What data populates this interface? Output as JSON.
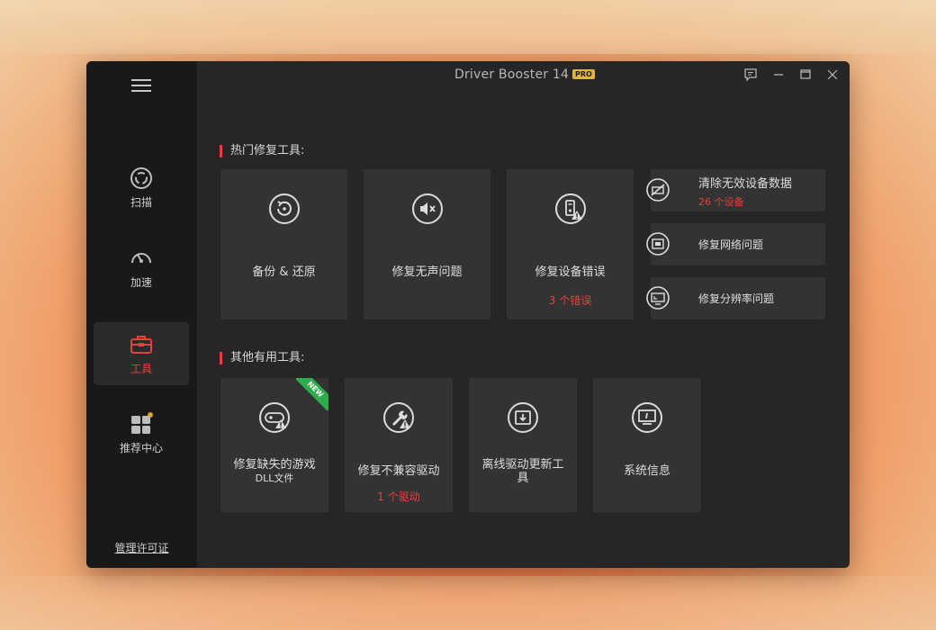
{
  "app": {
    "title": "Driver Booster 14",
    "badge": "PRO"
  },
  "sidebar": {
    "items": [
      {
        "label": "扫描",
        "icon": "scan-icon"
      },
      {
        "label": "加速",
        "icon": "speedometer-icon"
      },
      {
        "label": "工具",
        "icon": "toolbox-icon",
        "active": true
      },
      {
        "label": "推荐中心",
        "icon": "apps-grid-icon",
        "dot": true
      }
    ],
    "license_link": "管理许可证"
  },
  "sections": {
    "hot_tools": {
      "title": "热门修复工具:",
      "cards": [
        {
          "label": "备份 & 还原",
          "icon": "backup-restore-icon"
        },
        {
          "label": "修复无声问题",
          "icon": "speaker-mute-icon"
        },
        {
          "label": "修复设备错误",
          "sub": "3 个错误",
          "icon": "device-error-icon"
        }
      ],
      "side_cards": [
        {
          "label": "清除无效设备数据",
          "sub": "26 个设备",
          "icon": "invalid-device-icon"
        },
        {
          "label": "修复网络问题",
          "icon": "network-icon"
        },
        {
          "label": "修复分辨率问题",
          "icon": "resolution-icon"
        }
      ]
    },
    "other_tools": {
      "title": "其他有用工具:",
      "cards": [
        {
          "label": "修复缺失的游戏",
          "label2": "DLL文件",
          "badge": "NEW",
          "icon": "gamepad-warning-icon"
        },
        {
          "label": "修复不兼容驱动",
          "sub": "1 个驱动",
          "icon": "wrench-warning-icon"
        },
        {
          "label": "离线驱动更新工",
          "label2": "具",
          "icon": "offline-update-icon"
        },
        {
          "label": "系统信息",
          "icon": "system-info-icon"
        }
      ]
    }
  },
  "colors": {
    "accent": "#e8403a",
    "card_bg": "#333333",
    "sidebar_bg": "#191919",
    "new_badge": "#2eac4c",
    "pro_badge": "#e2b53a"
  }
}
